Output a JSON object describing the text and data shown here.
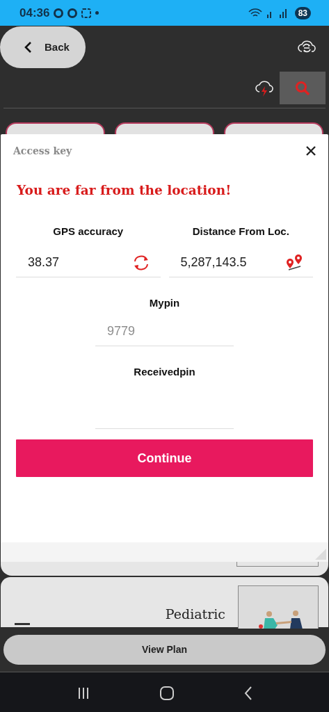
{
  "status_bar": {
    "time": "04:36",
    "battery": "83"
  },
  "header": {
    "back_label": "Back"
  },
  "dialog": {
    "title": "Access key",
    "message": "You are far from the location!",
    "fields": [
      {
        "label": "GPS accuracy",
        "value": "38.37",
        "kind": "refresh"
      },
      {
        "label": "Distance From Loc.",
        "value": "5,287,143.5",
        "kind": "route"
      }
    ],
    "pins": [
      {
        "label": "Mypin",
        "placeholder": "9779"
      },
      {
        "label": "Receivedpin"
      }
    ],
    "continue_label": "Continue"
  },
  "background": {
    "card_title": "Pediatric"
  },
  "footer": {
    "button_label": "View Plan"
  }
}
